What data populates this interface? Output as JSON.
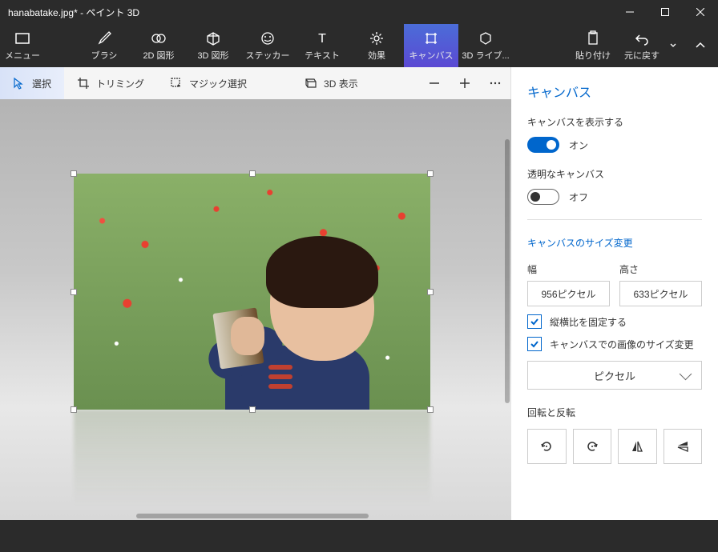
{
  "titlebar": {
    "title": "hanabatake.jpg* - ペイント 3D"
  },
  "ribbon": {
    "menu": "メニュー",
    "brush": "ブラシ",
    "shape2d": "2D 図形",
    "shape3d": "3D 図形",
    "sticker": "ステッカー",
    "text": "テキスト",
    "effects": "効果",
    "canvas": "キャンバス",
    "library3d": "3D ライブ...",
    "paste": "貼り付け",
    "undo": "元に戻す"
  },
  "toolbar": {
    "select": "選択",
    "crop": "トリミング",
    "magic": "マジック選択",
    "view3d": "3D 表示"
  },
  "panel": {
    "title": "キャンバス",
    "show_canvas": "キャンバスを表示する",
    "on": "オン",
    "transparent": "透明なキャンバス",
    "off": "オフ",
    "resize": "キャンバスのサイズ変更",
    "width_label": "幅",
    "height_label": "高さ",
    "width_value": "956ピクセル",
    "height_value": "633ピクセル",
    "lock_aspect": "縦横比を固定する",
    "resize_image": "キャンバスでの画像のサイズ変更",
    "unit": "ピクセル",
    "rotate_flip": "回転と反転"
  }
}
